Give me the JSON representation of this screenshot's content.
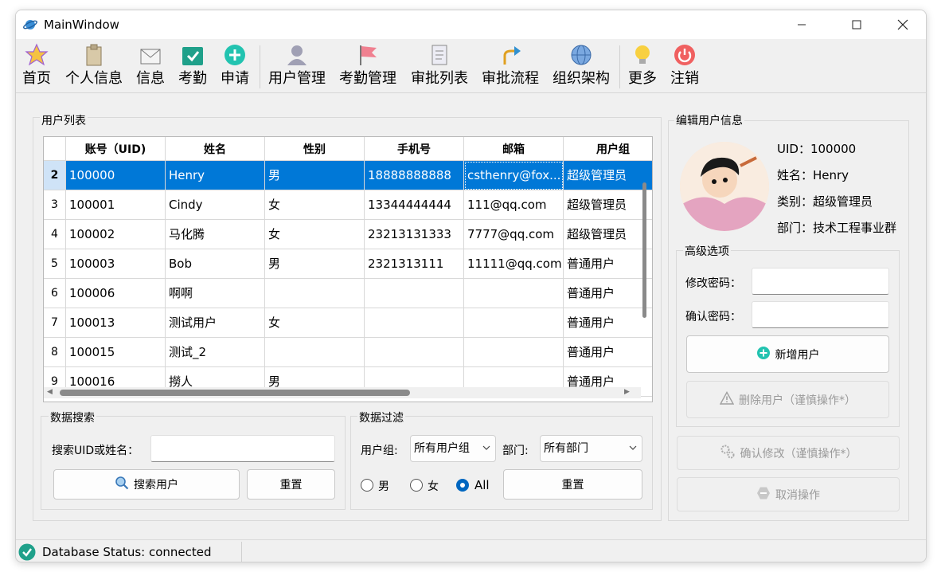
{
  "window": {
    "title": "MainWindow"
  },
  "toolbar": {
    "items": [
      {
        "label": "首页",
        "icon": "star-icon"
      },
      {
        "label": "个人信息",
        "icon": "clipboard-icon"
      },
      {
        "label": "信息",
        "icon": "envelope-icon"
      },
      {
        "label": "考勤",
        "icon": "calendar-check-icon"
      },
      {
        "label": "申请",
        "icon": "plus-circle-icon"
      },
      {
        "label": "用户管理",
        "icon": "user-icon"
      },
      {
        "label": "考勤管理",
        "icon": "flag-icon"
      },
      {
        "label": "审批列表",
        "icon": "document-icon"
      },
      {
        "label": "审批流程",
        "icon": "flow-arrow-icon"
      },
      {
        "label": "组织架构",
        "icon": "globe-icon"
      },
      {
        "label": "更多",
        "icon": "lightbulb-icon"
      },
      {
        "label": "注销",
        "icon": "power-icon"
      }
    ]
  },
  "user_list": {
    "title": "用户列表",
    "headers": [
      "账号（UID)",
      "姓名",
      "性别",
      "手机号",
      "邮箱",
      "用户组"
    ],
    "rows": [
      {
        "num": "2",
        "cells": [
          "100000",
          "Henry",
          "男",
          "18888888888",
          "csthenry@fox...",
          "超级管理员"
        ]
      },
      {
        "num": "3",
        "cells": [
          "100001",
          "Cindy",
          "女",
          "13344444444",
          "111@qq.com",
          "超级管理员"
        ]
      },
      {
        "num": "4",
        "cells": [
          "100002",
          "马化腾",
          "女",
          "23213131333",
          "7777@qq.com",
          "超级管理员"
        ]
      },
      {
        "num": "5",
        "cells": [
          "100003",
          "Bob",
          "男",
          "2321313111",
          "11111@qq.com",
          "普通用户"
        ]
      },
      {
        "num": "6",
        "cells": [
          "100006",
          "啊啊",
          "",
          "",
          "",
          "普通用户"
        ]
      },
      {
        "num": "7",
        "cells": [
          "100013",
          "测试用户",
          "女",
          "",
          "",
          "普通用户"
        ]
      },
      {
        "num": "8",
        "cells": [
          "100015",
          "测试_2",
          "",
          "",
          "",
          "普通用户"
        ]
      },
      {
        "num": "9",
        "cells": [
          "100016",
          "撈人",
          "男",
          "",
          "",
          "普通用户"
        ]
      }
    ]
  },
  "search": {
    "title": "数据搜索",
    "label": "搜索UID或姓名：",
    "value": "",
    "search_button": "搜索用户",
    "reset_button": "重置"
  },
  "filter": {
    "title": "数据过滤",
    "group_label": "用户组:",
    "group_value": "所有用户组",
    "dept_label": "部门:",
    "dept_value": "所有部门",
    "radio_male": "男",
    "radio_female": "女",
    "radio_all": "All",
    "reset_button": "重置"
  },
  "edit": {
    "title": "编辑用户信息",
    "uid": "UID：100000",
    "name": "姓名：Henry",
    "type": "类别：超级管理员",
    "dept": "部门：技术工程事业群",
    "advanced_title": "高级选项",
    "password_label": "修改密码：",
    "confirm_label": "确认密码：",
    "add_button": "新增用户",
    "delete_button": "删除用户（谨慎操作*）",
    "confirm_button": "确认修改（谨慎操作*）",
    "cancel_button": "取消操作"
  },
  "status": {
    "text": "Database Status: connected"
  }
}
